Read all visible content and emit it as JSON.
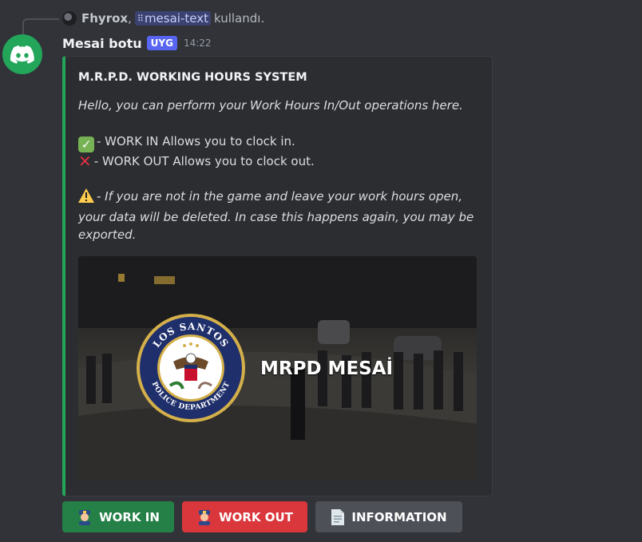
{
  "reply": {
    "user": "Fhyrox",
    "separator": ",",
    "command_icon": "slash-command-icon",
    "command": "mesai-text",
    "suffix": "kullandı."
  },
  "message": {
    "author": "Mesai botu",
    "badge": "UYG",
    "time": "14:22",
    "avatar_icon": "discord-logo-icon",
    "avatar_color": "#23a55a"
  },
  "embed": {
    "accent_color": "#23a55a",
    "title": "M.R.P.D. WORKING HOURS SYSTEM",
    "intro": "Hello, you can perform your Work Hours In/Out operations here.",
    "work_in_line": "- WORK IN Allows you to clock in.",
    "work_out_line": "- WORK OUT Allows you to clock out.",
    "warning_line_1": "- If you are not in the game and leave your work hours open,",
    "warning_line_2": "your data will be deleted. In case this happens again, you may be",
    "warning_line_3": "exported.",
    "image": {
      "caption": "MRPD MESAİ",
      "seal_top_text": "LOS SANTOS",
      "seal_bottom_text": "POLICE DEPARTMENT"
    }
  },
  "buttons": [
    {
      "label": "WORK IN",
      "icon": "police-officer-icon",
      "color": "#248046"
    },
    {
      "label": "WORK OUT",
      "icon": "police-officer-icon",
      "color": "#da373c"
    },
    {
      "label": "INFORMATION",
      "icon": "document-icon",
      "color": "#4e5058"
    }
  ]
}
